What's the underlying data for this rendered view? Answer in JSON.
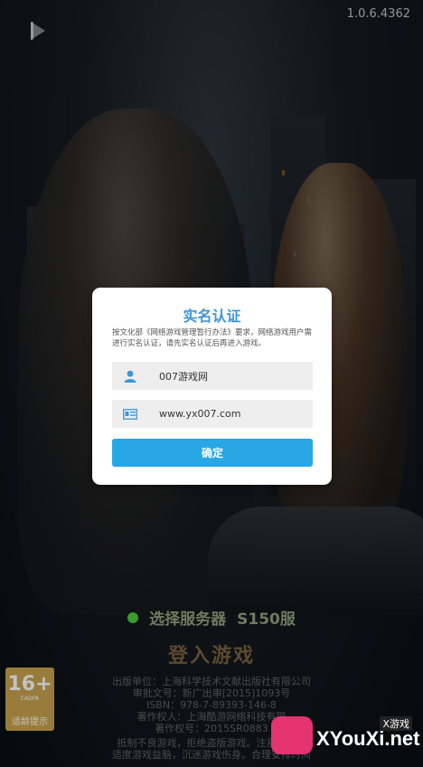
{
  "app": {
    "version": "1.0.6.4362"
  },
  "dialog": {
    "title": "实名认证",
    "description": "按文化部《网络游戏管理暂行办法》要求，网络游戏用户需进行实名认证，请先实名认证后再进入游戏。",
    "name_value": "007游戏网",
    "id_value": "www.yx007.com",
    "confirm_label": "确定"
  },
  "login": {
    "server_label": "选择服务器",
    "server_name": "S150服",
    "login_label": "登入游戏"
  },
  "credits": [
    "出版单位：上海科学技术文献出版社有限公司",
    "审批文号：新广出审[2015]1093号",
    "ISBN：978-7-89393-146-8",
    "著作权人：上海酷游网络科技有限",
    "著作权号：2015SR0883"
  ],
  "notice": [
    "抵制不良游戏，拒绝盗版游戏。注意自我保",
    "适度游戏益脑，沉迷游戏伤身。合理安排时间"
  ],
  "age_rating": {
    "number": "16+",
    "sub": "CADPA",
    "tip": "适龄提示"
  },
  "watermark": {
    "brand": "XYouXi.net",
    "tag": "X游戏"
  },
  "colors": {
    "accent": "#3d95d8",
    "button": "#27a7e4",
    "server_dot": "#3c9a2e"
  },
  "icons": {
    "back": "back-arrow-icon",
    "user": "user-icon",
    "id": "id-card-icon"
  }
}
